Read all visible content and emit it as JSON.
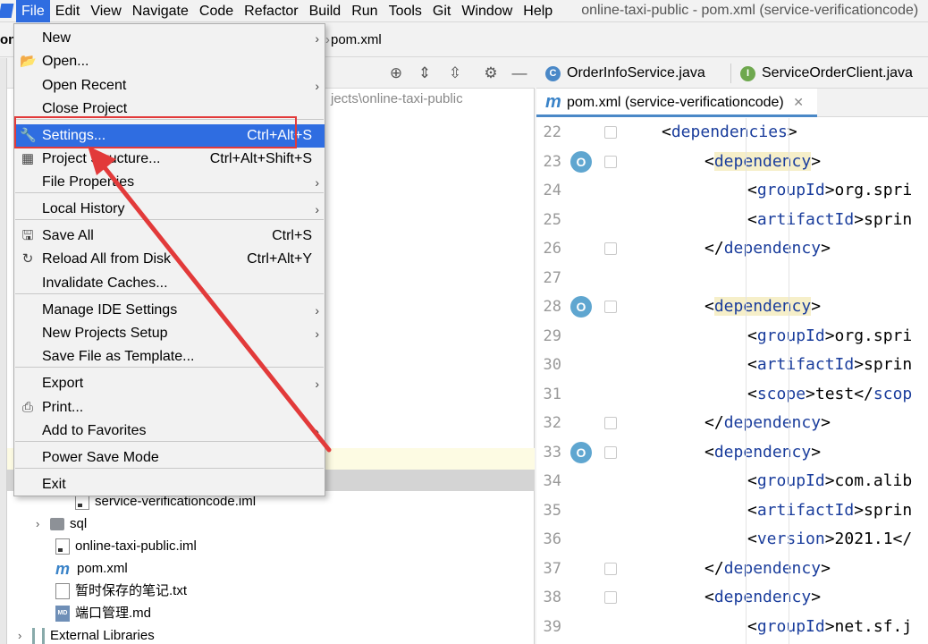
{
  "menubar": {
    "items": [
      "File",
      "Edit",
      "View",
      "Navigate",
      "Code",
      "Refactor",
      "Build",
      "Run",
      "Tools",
      "Git",
      "Window",
      "Help"
    ],
    "window_title": "online-taxi-public - pom.xml (service-verificationcode)"
  },
  "breadcrumb": {
    "prefix": "on",
    "file": "pom.xml"
  },
  "project": {
    "path_fragment": "jects\\online-taxi-public",
    "tree": [
      {
        "label": "service-verificationcode.iml",
        "icon": "iml-file-icon"
      },
      {
        "label": "sql",
        "icon": "folder-icon"
      },
      {
        "label": "online-taxi-public.iml",
        "icon": "iml-file-icon"
      },
      {
        "label": "pom.xml",
        "icon": "maven-icon"
      },
      {
        "label": "暂时保存的笔记.txt",
        "icon": "text-file-icon"
      },
      {
        "label": "端口管理.md",
        "icon": "markdown-file-icon"
      },
      {
        "label": "External Libraries",
        "icon": "library-icon"
      }
    ]
  },
  "editor": {
    "tabs_row1": [
      "OrderInfoService.java",
      "ServiceOrderClient.java"
    ],
    "active_tab": "pom.xml (service-verificationcode)",
    "lines": [
      {
        "n": "22",
        "indent": 1,
        "parts": [
          [
            "t",
            "<"
          ],
          [
            "tag",
            "dependencies"
          ],
          [
            "t",
            ">"
          ]
        ]
      },
      {
        "n": "23",
        "indent": 2,
        "parts": [
          [
            "t",
            "<"
          ],
          [
            "taghl",
            "dependency"
          ],
          [
            "t",
            ">"
          ]
        ]
      },
      {
        "n": "24",
        "indent": 3,
        "parts": [
          [
            "t",
            "<"
          ],
          [
            "tag",
            "groupId"
          ],
          [
            "t",
            ">org.spri"
          ]
        ]
      },
      {
        "n": "25",
        "indent": 3,
        "parts": [
          [
            "t",
            "<"
          ],
          [
            "tag",
            "artifactId"
          ],
          [
            "t",
            ">sprin"
          ]
        ]
      },
      {
        "n": "26",
        "indent": 2,
        "parts": [
          [
            "t",
            "</"
          ],
          [
            "tag",
            "dependency"
          ],
          [
            "t",
            ">"
          ]
        ]
      },
      {
        "n": "27",
        "indent": 0,
        "parts": []
      },
      {
        "n": "28",
        "indent": 2,
        "parts": [
          [
            "t",
            "<"
          ],
          [
            "taghl",
            "dependency"
          ],
          [
            "t",
            ">"
          ]
        ]
      },
      {
        "n": "29",
        "indent": 3,
        "parts": [
          [
            "t",
            "<"
          ],
          [
            "tag",
            "groupId"
          ],
          [
            "t",
            ">org.spri"
          ]
        ]
      },
      {
        "n": "30",
        "indent": 3,
        "parts": [
          [
            "t",
            "<"
          ],
          [
            "tag",
            "artifactId"
          ],
          [
            "t",
            ">sprin"
          ]
        ]
      },
      {
        "n": "31",
        "indent": 3,
        "parts": [
          [
            "t",
            "<"
          ],
          [
            "tag",
            "scope"
          ],
          [
            "t",
            ">test</"
          ],
          [
            "tag",
            "scop"
          ]
        ]
      },
      {
        "n": "32",
        "indent": 2,
        "parts": [
          [
            "t",
            "</"
          ],
          [
            "tag",
            "dependency"
          ],
          [
            "t",
            ">"
          ]
        ]
      },
      {
        "n": "33",
        "indent": 2,
        "parts": [
          [
            "t",
            "<"
          ],
          [
            "tag",
            "dependency"
          ],
          [
            "t",
            ">"
          ]
        ]
      },
      {
        "n": "34",
        "indent": 3,
        "parts": [
          [
            "t",
            "<"
          ],
          [
            "tag",
            "groupId"
          ],
          [
            "t",
            ">com.alib"
          ]
        ]
      },
      {
        "n": "35",
        "indent": 3,
        "parts": [
          [
            "t",
            "<"
          ],
          [
            "tag",
            "artifactId"
          ],
          [
            "t",
            ">sprin"
          ]
        ]
      },
      {
        "n": "36",
        "indent": 3,
        "parts": [
          [
            "t",
            "<"
          ],
          [
            "tag",
            "version"
          ],
          [
            "t",
            ">2021.1</"
          ]
        ]
      },
      {
        "n": "37",
        "indent": 2,
        "parts": [
          [
            "t",
            "</"
          ],
          [
            "tag",
            "dependency"
          ],
          [
            "t",
            ">"
          ]
        ]
      },
      {
        "n": "38",
        "indent": 2,
        "parts": [
          [
            "t",
            "<"
          ],
          [
            "tag",
            "dependency"
          ],
          [
            "t",
            ">"
          ]
        ]
      },
      {
        "n": "39",
        "indent": 3,
        "parts": [
          [
            "t",
            "<"
          ],
          [
            "tag",
            "groupId"
          ],
          [
            "t",
            ">net.sf.j"
          ]
        ]
      }
    ]
  },
  "file_menu": {
    "items": [
      {
        "label": "New",
        "shortcut": "",
        "submenu": true,
        "icon": ""
      },
      {
        "label": "Open...",
        "shortcut": "",
        "submenu": false,
        "icon": "folder-open-icon"
      },
      {
        "label": "Open Recent",
        "shortcut": "",
        "submenu": true,
        "icon": ""
      },
      {
        "label": "Close Project",
        "shortcut": "",
        "submenu": false,
        "icon": ""
      },
      {
        "label": "Settings...",
        "shortcut": "Ctrl+Alt+S",
        "submenu": false,
        "icon": "wrench-icon",
        "highlighted": true
      },
      {
        "label": "Project Structure...",
        "shortcut": "Ctrl+Alt+Shift+S",
        "submenu": false,
        "icon": "project-structure-icon"
      },
      {
        "label": "File Properties",
        "shortcut": "",
        "submenu": true,
        "icon": ""
      },
      {
        "label": "Local History",
        "shortcut": "",
        "submenu": true,
        "icon": ""
      },
      {
        "label": "Save All",
        "shortcut": "Ctrl+S",
        "submenu": false,
        "icon": "save-icon"
      },
      {
        "label": "Reload All from Disk",
        "shortcut": "Ctrl+Alt+Y",
        "submenu": false,
        "icon": "reload-icon"
      },
      {
        "label": "Invalidate Caches...",
        "shortcut": "",
        "submenu": false,
        "icon": ""
      },
      {
        "label": "Manage IDE Settings",
        "shortcut": "",
        "submenu": true,
        "icon": ""
      },
      {
        "label": "New Projects Setup",
        "shortcut": "",
        "submenu": true,
        "icon": ""
      },
      {
        "label": "Save File as Template...",
        "shortcut": "",
        "submenu": false,
        "icon": ""
      },
      {
        "label": "Export",
        "shortcut": "",
        "submenu": true,
        "icon": ""
      },
      {
        "label": "Print...",
        "shortcut": "",
        "submenu": false,
        "icon": "print-icon"
      },
      {
        "label": "Add to Favorites",
        "shortcut": "",
        "submenu": true,
        "icon": ""
      },
      {
        "label": "Power Save Mode",
        "shortcut": "",
        "submenu": false,
        "icon": ""
      },
      {
        "label": "Exit",
        "shortcut": "",
        "submenu": false,
        "icon": ""
      }
    ]
  },
  "colors": {
    "accent": "#2f6de1",
    "annotation": "#e23a3a"
  }
}
